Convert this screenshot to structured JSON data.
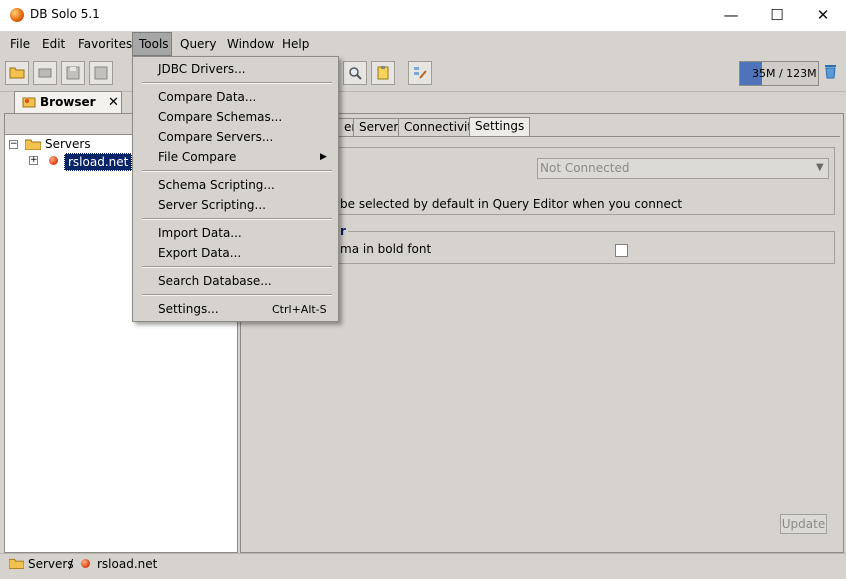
{
  "window": {
    "title": "DB Solo  5.1",
    "minimize": "—",
    "maximize": "☐",
    "close": "✕"
  },
  "menubar": [
    "File",
    "Edit",
    "Favorites",
    "Tools",
    "Query",
    "Window",
    "Help"
  ],
  "toolbar": {
    "icons": [
      "open-folder-icon",
      "connect-icon",
      "save-icon",
      "save-all-icon",
      "search-icon",
      "clipboard-icon",
      "settings-edit-icon"
    ],
    "memory_text": "35M / 123M",
    "memory_used_fraction": 0.28
  },
  "browser": {
    "tab_label": "Browser",
    "tab_close": "✕",
    "tree": {
      "root": "Servers",
      "expander_root": "−",
      "expander_child": "+",
      "child": "rsload.net"
    }
  },
  "settings": {
    "tabs": [
      "er",
      "Server",
      "Connectivity",
      "Settings"
    ],
    "connection_select": "Not Connected",
    "schema_text": "be selected by default in Query Editor when you connect",
    "group2_title": "r",
    "bold_text": "ma in bold font",
    "update_button": "Update"
  },
  "status": {
    "servers": "Servers",
    "separator": "/",
    "server": "rsload.net"
  },
  "tools_menu": {
    "items": [
      "JDBC Drivers...",
      "Compare Data...",
      "Compare Schemas...",
      "Compare Servers...",
      "File Compare",
      "Schema Scripting...",
      "Server Scripting...",
      "Import Data...",
      "Export Data...",
      "Search Database...",
      "Settings..."
    ],
    "settings_shortcut": "Ctrl+Alt-S",
    "submenu_arrow": "▶"
  }
}
